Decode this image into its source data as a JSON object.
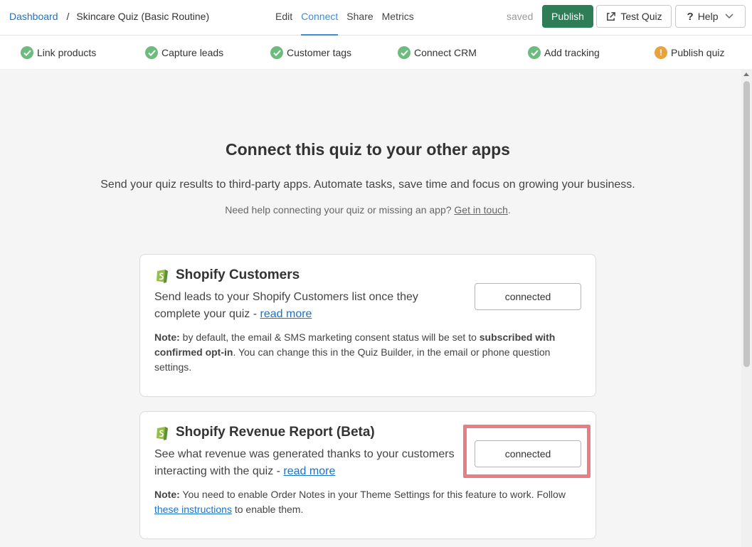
{
  "breadcrumb": {
    "root": "Dashboard",
    "separator": "/",
    "current": "Skincare Quiz (Basic Routine)"
  },
  "nav": {
    "tabs": [
      "Edit",
      "Connect",
      "Share",
      "Metrics"
    ],
    "active": "Connect"
  },
  "header": {
    "status": "saved",
    "publish_label": "Publish",
    "test_label": "Test Quiz",
    "help_label": "Help"
  },
  "steps": [
    {
      "label": "Link products",
      "state": "done"
    },
    {
      "label": "Capture leads",
      "state": "done"
    },
    {
      "label": "Customer tags",
      "state": "done"
    },
    {
      "label": "Connect CRM",
      "state": "done"
    },
    {
      "label": "Add tracking",
      "state": "done"
    },
    {
      "label": "Publish quiz",
      "state": "warning"
    }
  ],
  "main": {
    "title": "Connect this quiz to your other apps",
    "subtitle": "Send your quiz results to third-party apps. Automate tasks, save time and focus on growing your business.",
    "help_text": "Need help connecting your quiz or missing an app?",
    "help_link": "Get in touch",
    "help_end": "."
  },
  "cards": [
    {
      "title": "Shopify Customers",
      "desc": "Send leads to your Shopify Customers list once they complete your quiz - ",
      "link": "read more",
      "button": "connected",
      "note_label": "Note:",
      "note_a": " by default, the email & SMS marketing consent status will be set to ",
      "note_bold": "subscribed with confirmed opt-in",
      "note_b": ". You can change this in the Quiz Builder, in the email or phone question settings."
    },
    {
      "title": "Shopify Revenue Report (Beta)",
      "desc": "See what revenue was generated thanks to your customers interacting with the quiz - ",
      "link": "read more",
      "button": "connected",
      "note_label": "Note:",
      "note_a": " You need to enable Order Notes in your Theme Settings for this feature to work. Follow ",
      "note_link": "these instructions",
      "note_b": " to enable them."
    }
  ],
  "colors": {
    "publish": "#2f7d56",
    "active_tab": "#3b8fd6",
    "check": "#6dbb7e",
    "warning": "#e8a33c",
    "highlight": "#e87e84"
  }
}
